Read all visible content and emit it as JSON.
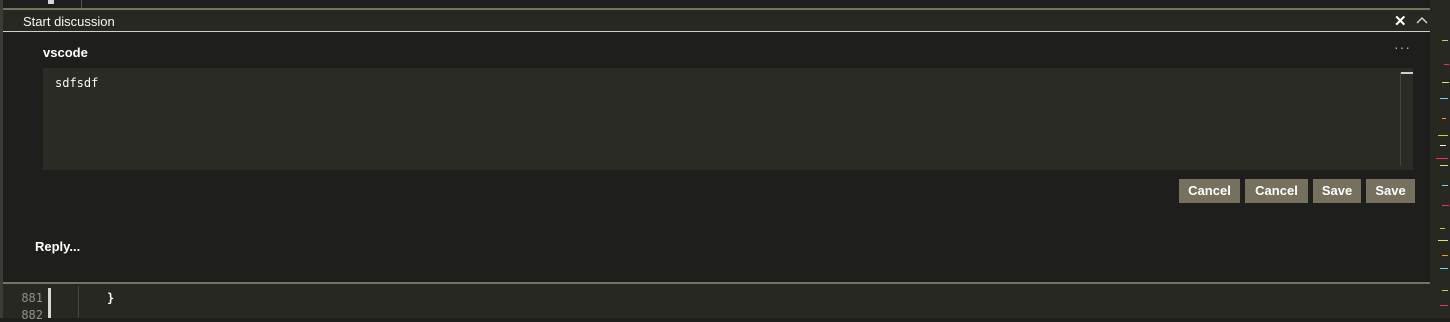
{
  "widget": {
    "title": "Start discussion",
    "close_glyph": "✕",
    "collapse_icon": "chevron-up-icon",
    "author": "vscode",
    "more_glyph": "···",
    "draft_text": "sdfsdf",
    "buttons": {
      "cancel_1": "Cancel",
      "cancel_2": "Cancel",
      "save_1": "Save",
      "save_2": "Save"
    },
    "reply_placeholder": "Reply..."
  },
  "code": {
    "lines": [
      {
        "number": "881",
        "text": "}"
      },
      {
        "number": "882",
        "text": ""
      }
    ]
  },
  "colors": {
    "accent": "#75715e",
    "background": "#1e1f1c",
    "editor_background": "#272822",
    "text": "#f8f8f2"
  }
}
